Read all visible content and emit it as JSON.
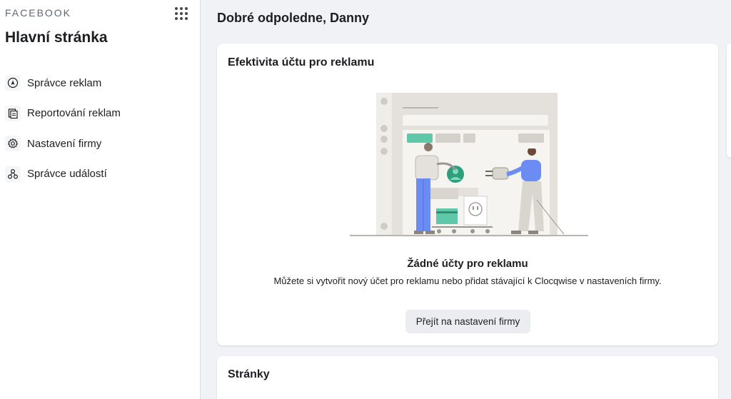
{
  "sidebar": {
    "brand": "FACEBOOK",
    "title": "Hlavní stránka",
    "items": [
      {
        "label": "Správce reklam",
        "icon": "ads-manager-icon"
      },
      {
        "label": "Reportování reklam",
        "icon": "ads-reporting-icon"
      },
      {
        "label": "Nastavení firmy",
        "icon": "gear-icon"
      },
      {
        "label": "Správce událostí",
        "icon": "events-manager-icon"
      }
    ]
  },
  "main": {
    "greeting": "Dobré odpoledne, Danny",
    "ad_accounts_card": {
      "title": "Efektivita účtu pro reklamu",
      "empty_title": "Žádné účty pro reklamu",
      "empty_description": "Můžete si vytvořit nový účet pro reklamu nebo přidat stávající k Clocqwise v nastaveních firmy.",
      "button_label": "Přejít na nastavení firmy"
    },
    "pages_card": {
      "title": "Stránky"
    }
  },
  "colors": {
    "accent_green": "#5ec8a8",
    "illustration_blue": "#6b8cf2",
    "illustration_gray": "#d9d6d0"
  }
}
